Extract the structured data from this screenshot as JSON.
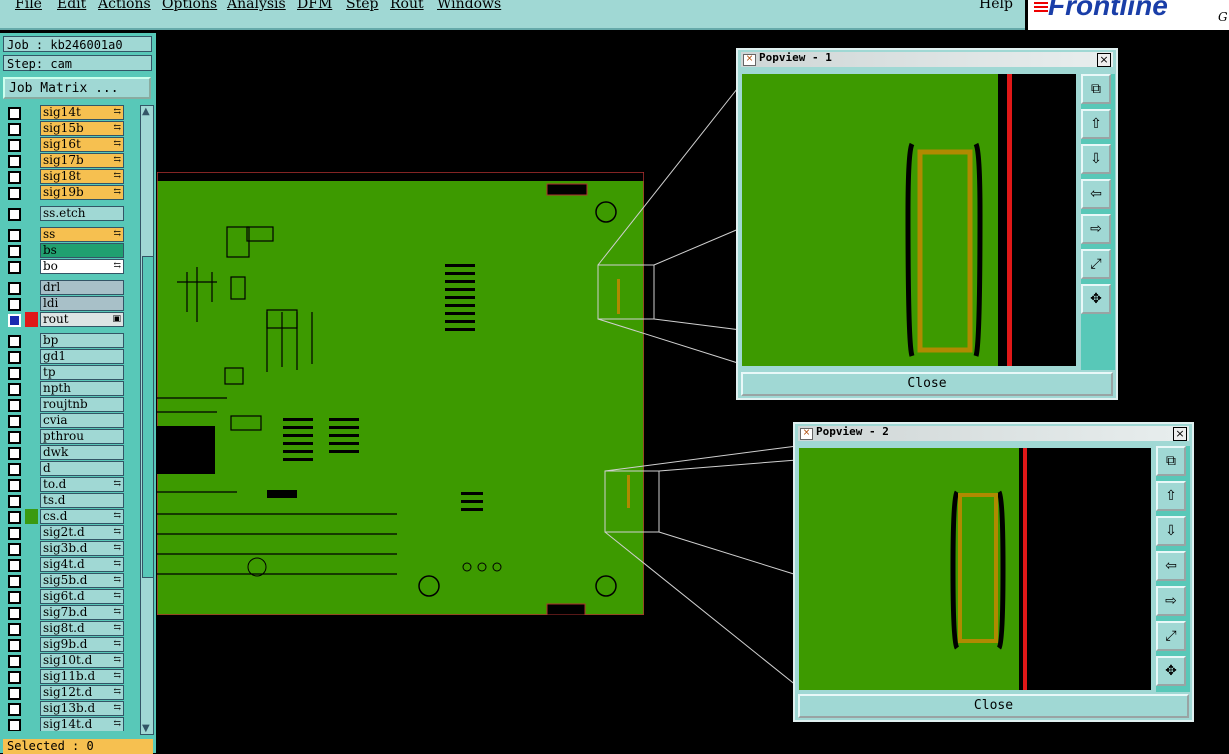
{
  "menubar": {
    "items": [
      "File",
      "Edit",
      "Actions",
      "Options",
      "Analysis",
      "DFM",
      "Step",
      "Rout",
      "Windows"
    ],
    "help": "Help"
  },
  "logo": {
    "text": "Frontline",
    "fragment_g": "G"
  },
  "job_info": {
    "job": "Job : kb246001a0",
    "step": "Step: cam"
  },
  "job_matrix_label": "Job Matrix ...",
  "layers": [
    {
      "name": "sig14t",
      "color": "#f6c050",
      "mark": "⇆",
      "swatch": ""
    },
    {
      "name": "sig15b",
      "color": "#f6c050",
      "mark": "⇆",
      "swatch": ""
    },
    {
      "name": "sig16t",
      "color": "#f6c050",
      "mark": "⇆",
      "swatch": ""
    },
    {
      "name": "sig17b",
      "color": "#f6c050",
      "mark": "⇆",
      "swatch": ""
    },
    {
      "name": "sig18t",
      "color": "#f6c050",
      "mark": "⇆",
      "swatch": ""
    },
    {
      "name": "sig19b",
      "color": "#f6c050",
      "mark": "⇆",
      "swatch": ""
    },
    {
      "name": "ss.etch",
      "color": "#a0d8d4",
      "mark": "",
      "swatch": "",
      "gap": true
    },
    {
      "name": "ss",
      "color": "#f6c050",
      "mark": "⇆",
      "swatch": "",
      "gap": true
    },
    {
      "name": "bs",
      "color": "#20a070",
      "mark": "",
      "swatch": ""
    },
    {
      "name": "bo",
      "color": "#ffffff",
      "mark": "⇆",
      "swatch": ""
    },
    {
      "name": "drl",
      "color": "#a8c0c8",
      "mark": "",
      "swatch": "",
      "gap": true
    },
    {
      "name": "ldi",
      "color": "#a8c0c8",
      "mark": "",
      "swatch": ""
    },
    {
      "name": "rout",
      "color": "#dde4e4",
      "mark": "▣",
      "swatch": "#e01818",
      "selected": true
    },
    {
      "name": "bp",
      "color": "#a0d8d4",
      "mark": "",
      "swatch": "",
      "gap": true
    },
    {
      "name": "gd1",
      "color": "#a0d8d4",
      "mark": "",
      "swatch": ""
    },
    {
      "name": "tp",
      "color": "#a0d8d4",
      "mark": "",
      "swatch": ""
    },
    {
      "name": "npth",
      "color": "#a0d8d4",
      "mark": "",
      "swatch": ""
    },
    {
      "name": "roujtnb",
      "color": "#a0d8d4",
      "mark": "",
      "swatch": ""
    },
    {
      "name": "cvia",
      "color": "#a0d8d4",
      "mark": "",
      "swatch": ""
    },
    {
      "name": "pthrou",
      "color": "#a0d8d4",
      "mark": "",
      "swatch": ""
    },
    {
      "name": "dwk",
      "color": "#a0d8d4",
      "mark": "",
      "swatch": ""
    },
    {
      "name": "d",
      "color": "#a0d8d4",
      "mark": "",
      "swatch": ""
    },
    {
      "name": "to.d",
      "color": "#a0d8d4",
      "mark": "⇆",
      "swatch": ""
    },
    {
      "name": "ts.d",
      "color": "#a0d8d4",
      "mark": "",
      "swatch": ""
    },
    {
      "name": "cs.d",
      "color": "#a0d8d4",
      "mark": "⇆",
      "swatch": "#3a9a10"
    },
    {
      "name": "sig2t.d",
      "color": "#a0d8d4",
      "mark": "⇆",
      "swatch": ""
    },
    {
      "name": "sig3b.d",
      "color": "#a0d8d4",
      "mark": "⇆",
      "swatch": ""
    },
    {
      "name": "sig4t.d",
      "color": "#a0d8d4",
      "mark": "⇆",
      "swatch": ""
    },
    {
      "name": "sig5b.d",
      "color": "#a0d8d4",
      "mark": "⇆",
      "swatch": ""
    },
    {
      "name": "sig6t.d",
      "color": "#a0d8d4",
      "mark": "⇆",
      "swatch": ""
    },
    {
      "name": "sig7b.d",
      "color": "#a0d8d4",
      "mark": "⇆",
      "swatch": ""
    },
    {
      "name": "sig8t.d",
      "color": "#a0d8d4",
      "mark": "⇆",
      "swatch": ""
    },
    {
      "name": "sig9b.d",
      "color": "#a0d8d4",
      "mark": "⇆",
      "swatch": ""
    },
    {
      "name": "sig10t.d",
      "color": "#a0d8d4",
      "mark": "⇆",
      "swatch": ""
    },
    {
      "name": "sig11b.d",
      "color": "#a0d8d4",
      "mark": "⇆",
      "swatch": ""
    },
    {
      "name": "sig12t.d",
      "color": "#a0d8d4",
      "mark": "⇆",
      "swatch": ""
    },
    {
      "name": "sig13b.d",
      "color": "#a0d8d4",
      "mark": "⇆",
      "swatch": ""
    },
    {
      "name": "sig14t.d",
      "color": "#a0d8d4",
      "mark": "⇆",
      "swatch": ""
    }
  ],
  "status": {
    "selected": "Selected : 0"
  },
  "popviews": [
    {
      "title": "Popview - 1",
      "close_label": "Close"
    },
    {
      "title": "Popview - 2",
      "close_label": "Close"
    }
  ],
  "colors": {
    "board": "#3d9a00",
    "panel": "#a0d8d4",
    "panel_dark": "#58c8b8",
    "rout": "#e01818",
    "highlight": "#f6c050"
  }
}
